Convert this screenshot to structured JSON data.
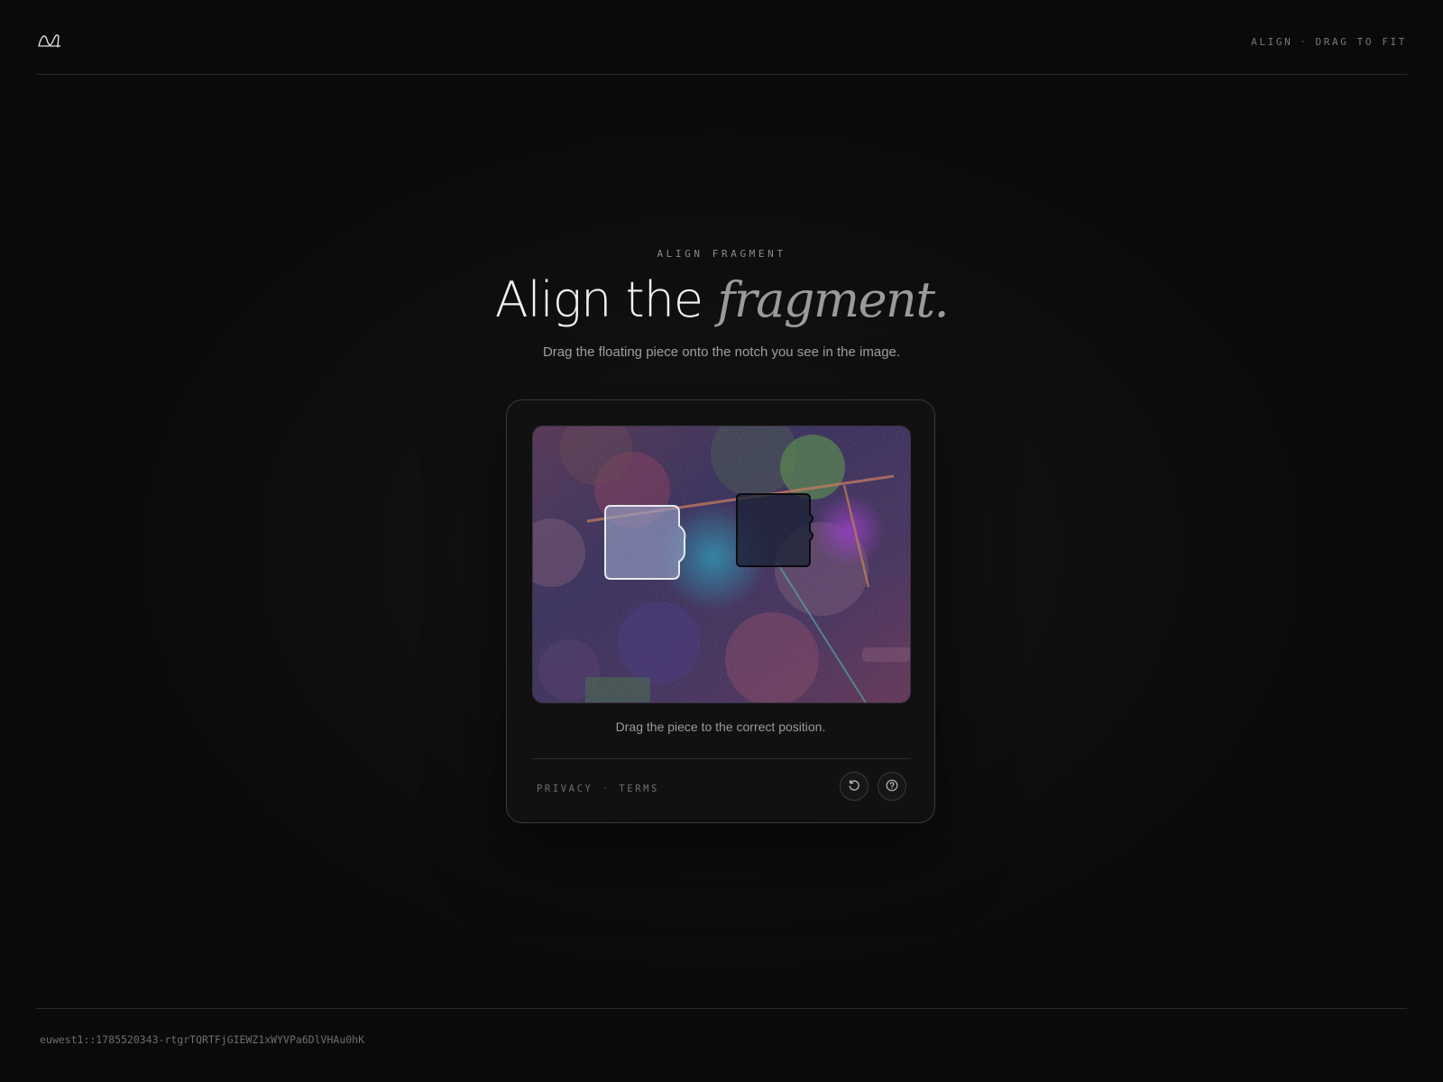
{
  "header": {
    "logo_icon": "wave-logo-icon",
    "tag_primary": "ALIGN",
    "tag_separator": "·",
    "tag_secondary": "DRAG TO FIT"
  },
  "hero": {
    "eyebrow": "ALIGN FRAGMENT",
    "title_plain": "Align the",
    "title_accent": "fragment.",
    "subtitle": "Drag the floating piece onto the notch you see in the image."
  },
  "captcha": {
    "instruction": "Drag the piece to the correct position.",
    "footer_links": {
      "privacy": "PRIVACY",
      "separator": "·",
      "terms": "TERMS"
    },
    "buttons": {
      "refresh_icon": "refresh-icon",
      "help_icon": "help-icon"
    }
  },
  "footer": {
    "session_id": "euwest1::1785520343-rtgrTQRTFjGIEWZ1xWYVPa6DlVHAu0hK"
  },
  "colors": {
    "background": "#0c0c0c",
    "card": "#111111",
    "text_primary": "#f2f2f2",
    "text_muted": "#9a9a9a"
  }
}
